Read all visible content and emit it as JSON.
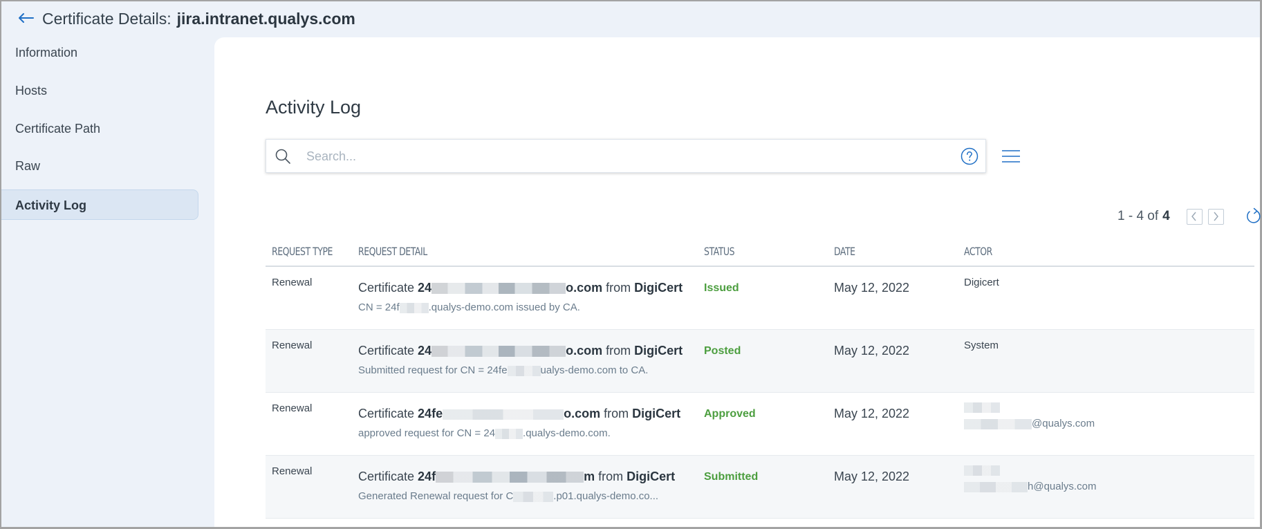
{
  "header": {
    "back_icon": "arrow-left-icon",
    "title_prefix": "Certificate Details:",
    "title_host": "jira.intranet.qualys.com"
  },
  "sidebar": {
    "items": [
      {
        "label": "Information",
        "active": false
      },
      {
        "label": "Hosts",
        "active": false
      },
      {
        "label": "Certificate Path",
        "active": false
      },
      {
        "label": "Raw",
        "active": false
      },
      {
        "label": "Activity Log",
        "active": true
      }
    ]
  },
  "main": {
    "section_title": "Activity Log",
    "search": {
      "placeholder": "Search...",
      "value": "",
      "search_icon": "search-icon",
      "help_icon": "help-circle-icon"
    },
    "menu_icon": "hamburger-menu-icon",
    "pagination": {
      "range": "1 - 4 of",
      "total": "4",
      "prev_icon": "chevron-left-icon",
      "next_icon": "chevron-right-icon",
      "refresh_icon": "refresh-icon"
    },
    "table": {
      "columns": [
        "REQUEST TYPE",
        "REQUEST DETAIL",
        "STATUS",
        "DATE",
        "ACTOR"
      ],
      "rows": [
        {
          "request_type": "Renewal",
          "detail_prefix": "Certificate",
          "detail_cert_start": "24",
          "detail_cert_end": "o.com",
          "detail_from": "from",
          "detail_ca": "DigiCert",
          "detail_sub_start": "CN = 24f",
          "detail_sub_end": ".qualys-demo.com issued by CA.",
          "status": "Issued",
          "date": "May 12, 2022",
          "actor": "Digicert"
        },
        {
          "request_type": "Renewal",
          "detail_prefix": "Certificate",
          "detail_cert_start": "24",
          "detail_cert_end": "o.com",
          "detail_from": "from",
          "detail_ca": "DigiCert",
          "detail_sub_start": "Submitted request for CN = 24fe",
          "detail_sub_end": "ualys-demo.com to CA.",
          "status": "Posted",
          "date": "May 12, 2022",
          "actor": "System"
        },
        {
          "request_type": "Renewal",
          "detail_prefix": "Certificate",
          "detail_cert_start": "24fe",
          "detail_cert_end": "o.com",
          "detail_from": "from",
          "detail_ca": "DigiCert",
          "detail_sub_start": "approved request for CN = 24",
          "detail_sub_end": ".qualys-demo.com.",
          "status": "Approved",
          "date": "May 12, 2022",
          "actor_email_end": "@qualys.com"
        },
        {
          "request_type": "Renewal",
          "detail_prefix": "Certificate",
          "detail_cert_start": "24f",
          "detail_cert_end": "m",
          "detail_from": "from",
          "detail_ca": "DigiCert",
          "detail_sub_start": "Generated Renewal request for C",
          "detail_sub_end": ".p01.qualys-demo.co...",
          "status": "Submitted",
          "date": "May 12, 2022",
          "actor_email_end": "h@qualys.com"
        }
      ]
    }
  },
  "colors": {
    "accent": "#1f6fc5",
    "status_green": "#4c9e3f",
    "page_bg": "#edf2f9",
    "active_item_bg": "#dbe6f3"
  }
}
